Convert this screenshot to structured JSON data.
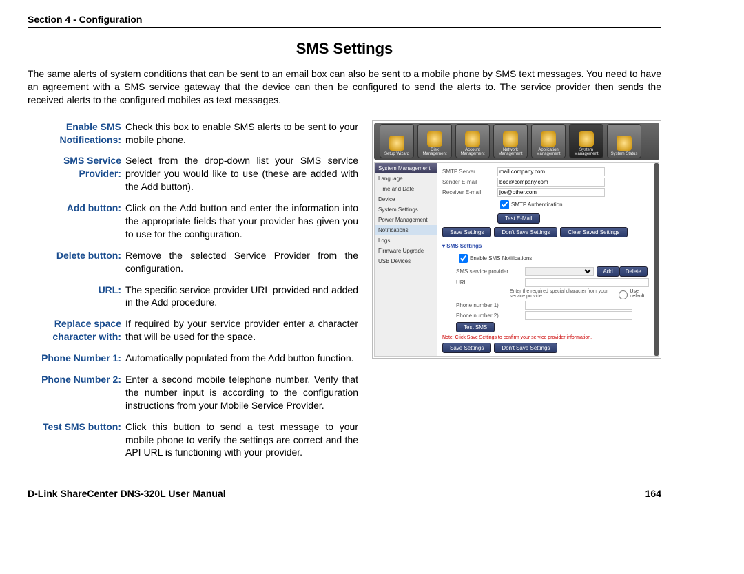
{
  "header": {
    "section": "Section 4 - Configuration"
  },
  "title": "SMS Settings",
  "intro": "The same alerts of system conditions that can be sent to an email box can also be sent to a mobile phone by SMS text messages. You need to have an agreement with a SMS service gateway that the device can then be configured to send the alerts to. The service provider then sends the received alerts to the configured mobiles as text messages.",
  "definitions": [
    {
      "label": "Enable SMS Notifications:",
      "desc": "Check this box to enable SMS alerts to be sent to your mobile phone."
    },
    {
      "label": "SMS Service Provider:",
      "desc": "Select from the drop-down list your SMS service provider you would like to use (these are added with the Add button)."
    },
    {
      "label": "Add button:",
      "desc": "Click on the Add button and enter the information into the appropriate fields that your provider has given you to use for the configuration."
    },
    {
      "label": "Delete button:",
      "desc": "Remove the selected Service Provider from the configuration."
    },
    {
      "label": "URL:",
      "desc": "The specific service provider URL provided and added in the Add procedure."
    },
    {
      "label": "Replace space character with:",
      "desc": "If required by your service provider enter a character that will be used for the space."
    },
    {
      "label": "Phone Number 1:",
      "desc": "Automatically populated from the Add button function."
    },
    {
      "label": "Phone Number 2:",
      "desc": "Enter a second mobile telephone number. Verify that the number input is according to the configuration instructions from your Mobile Service Provider."
    },
    {
      "label": "Test SMS button:",
      "desc": "Click this button to send a test message to your mobile phone to verify the settings are correct and the API URL is functioning with your provider."
    }
  ],
  "screenshot": {
    "toolbar": [
      "Setup Wizard",
      "Disk Management",
      "Account Management",
      "Network Management",
      "Application Management",
      "System Management",
      "System Status"
    ],
    "sidebar_head": "System Management",
    "sidebar": [
      "Language",
      "Time and Date",
      "Device",
      "System Settings",
      "Power Management",
      "Notifications",
      "Logs",
      "Firmware Upgrade",
      "USB Devices"
    ],
    "smtp_label": "SMTP Server",
    "smtp_val": "mail.company.com",
    "sender_label": "Sender E-mail",
    "sender_val": "bob@company.com",
    "recv_label": "Receiver E-mail",
    "recv_val": "joe@other.com",
    "smtp_auth": "SMTP Authentication",
    "test_email": "Test E-Mail",
    "save": "Save Settings",
    "dontsave": "Don't Save Settings",
    "clear": "Clear Saved Settings",
    "sms_title": "SMS Settings",
    "enable_sms": "Enable SMS Notifications",
    "sms_prov": "SMS service provider",
    "add": "Add",
    "delete": "Delete",
    "url": "URL",
    "url_note": "Enter the required special character from your service provide",
    "use_default": "Use default",
    "phone1": "Phone number 1)",
    "phone2": "Phone number 2)",
    "test_sms": "Test SMS",
    "note": "Note: Click Save Settings to confirm your service provider information."
  },
  "footer": {
    "left": "D-Link ShareCenter DNS-320L User Manual",
    "right": "164"
  }
}
